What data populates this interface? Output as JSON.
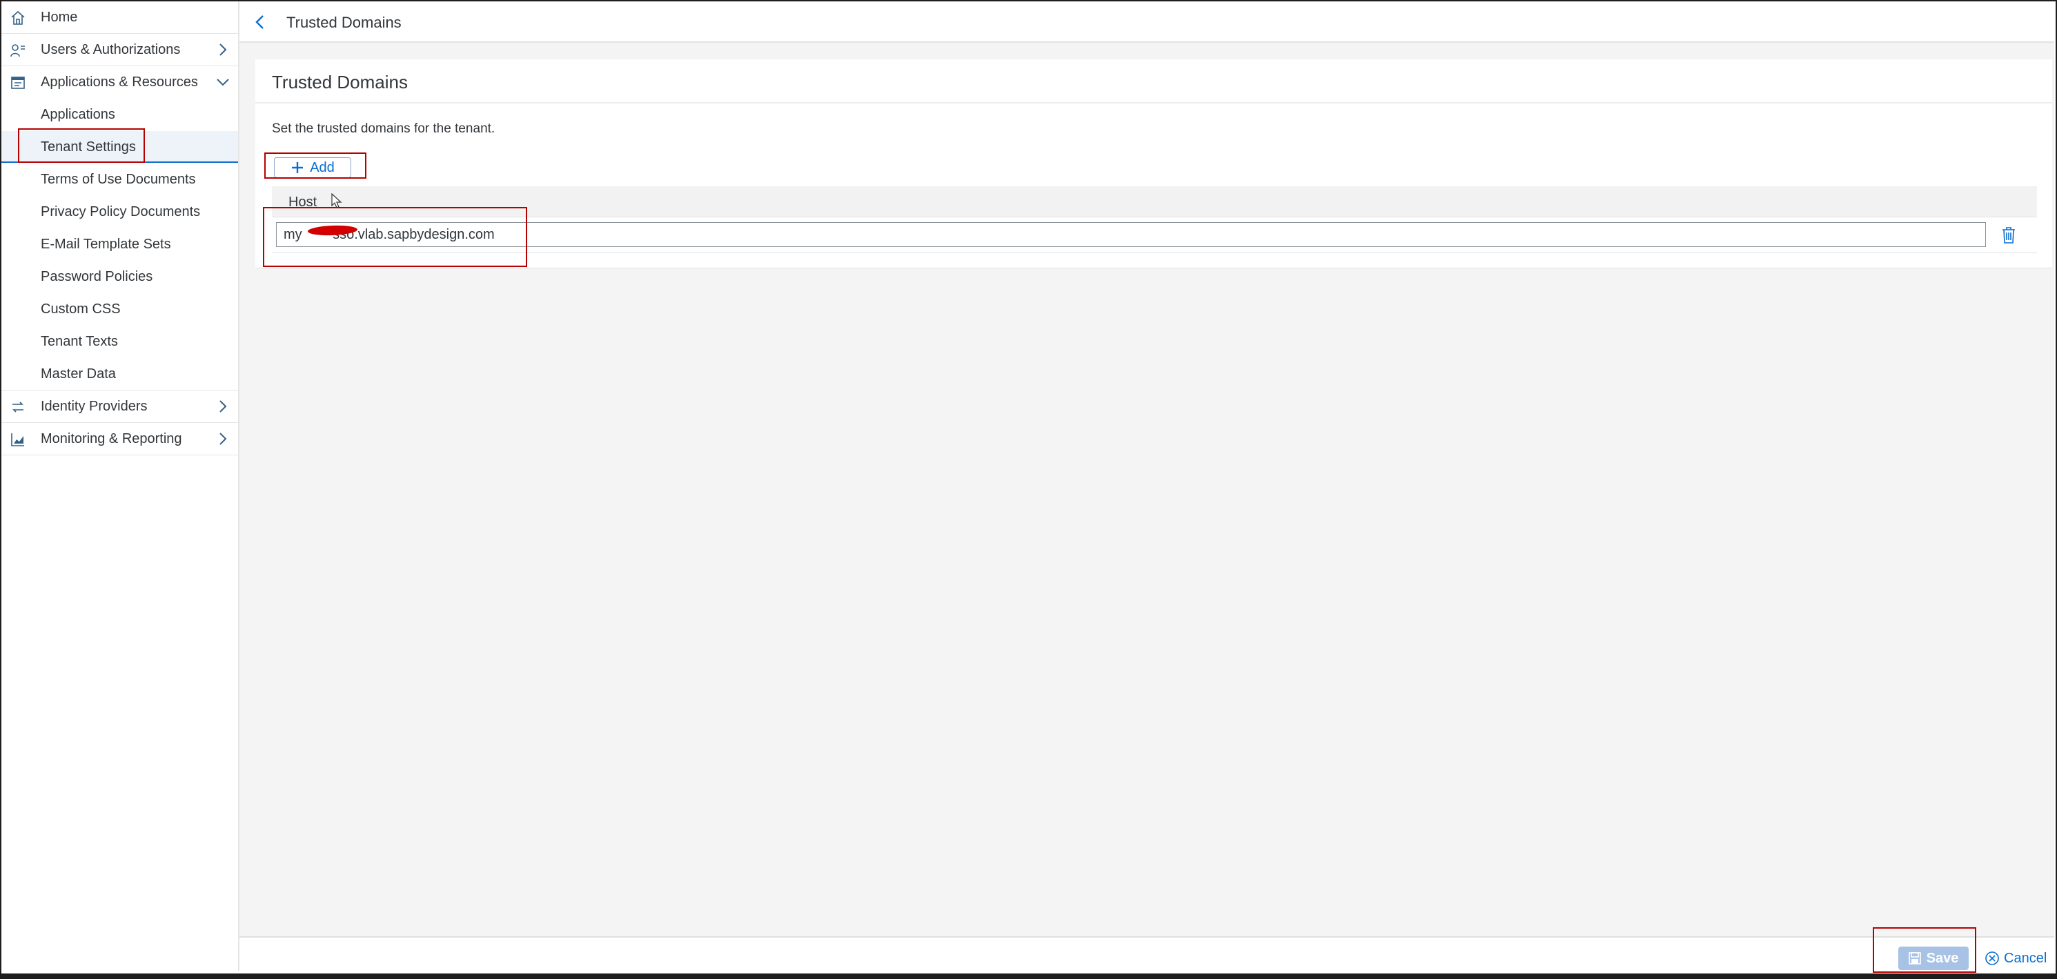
{
  "sidebar": {
    "items": [
      {
        "label": "Home",
        "icon": "home-icon"
      },
      {
        "label": "Users & Authorizations",
        "icon": "users-icon"
      },
      {
        "label": "Applications & Resources",
        "icon": "applications-icon"
      },
      {
        "label": "Applications"
      },
      {
        "label": "Tenant Settings"
      },
      {
        "label": "Terms of Use Documents"
      },
      {
        "label": "Privacy Policy Documents"
      },
      {
        "label": "E-Mail Template Sets"
      },
      {
        "label": "Password Policies"
      },
      {
        "label": "Custom CSS"
      },
      {
        "label": "Tenant Texts"
      },
      {
        "label": "Master Data"
      },
      {
        "label": "Identity Providers",
        "icon": "identity-providers-icon"
      },
      {
        "label": "Monitoring & Reporting",
        "icon": "monitoring-icon"
      }
    ]
  },
  "header": {
    "title": "Trusted Domains"
  },
  "panel": {
    "title": "Trusted Domains",
    "description": "Set the trusted domains for the tenant.",
    "add_label": "Add",
    "table": {
      "columns": [
        "Host"
      ],
      "rows": [
        {
          "host": "my        sso.vlab.sapbydesign.com"
        }
      ]
    }
  },
  "footer": {
    "save_label": "Save",
    "cancel_label": "Cancel"
  },
  "colors": {
    "accent": "#0a6ed1",
    "highlight_box": "#b50000",
    "save_disabled": "#a8c2e6"
  }
}
